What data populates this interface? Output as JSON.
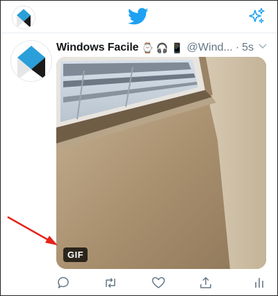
{
  "app": "Twitter",
  "icons": {
    "top_left": "profile-avatar-icon",
    "center": "twitter-bird-icon",
    "top_right": "sparkle-icon"
  },
  "colors": {
    "accent": "#1da1f2",
    "muted": "#657786",
    "text": "#14171a",
    "arrow": "#e5231b"
  },
  "tweet": {
    "display_name": "Windows Facile",
    "emojis": [
      "⌚",
      "🎧",
      "📱"
    ],
    "handle": "@Wind...",
    "separator": "·",
    "time": "5s",
    "media": {
      "type": "gif",
      "badge": "GIF"
    },
    "actions": [
      "reply-icon",
      "retweet-icon",
      "like-icon",
      "share-icon",
      "analytics-icon"
    ]
  }
}
